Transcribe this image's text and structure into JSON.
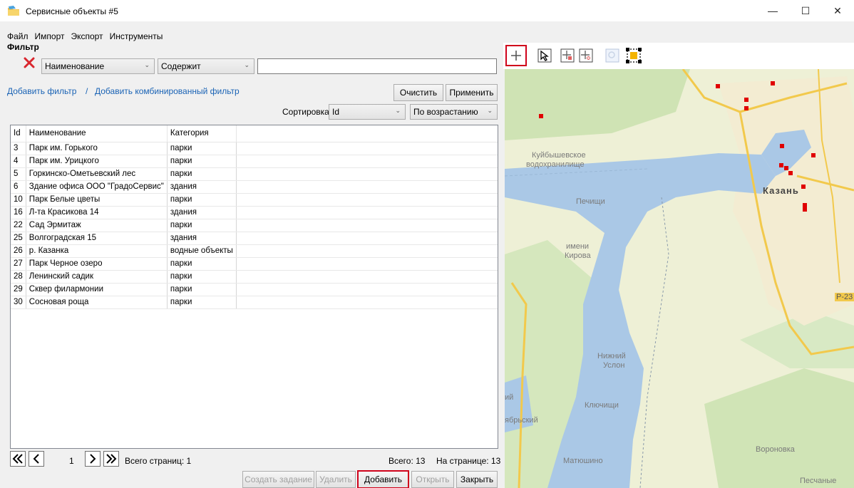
{
  "window": {
    "title": "Сервисные объекты #5",
    "minimize": "—",
    "maximize": "☐",
    "close": "✕"
  },
  "menu": [
    "Файл",
    "Импорт",
    "Экспорт",
    "Инструменты"
  ],
  "filter": {
    "label": "Фильтр",
    "field": "Наименование",
    "operator": "Содержит",
    "value": "",
    "add_filter": "Добавить фильтр",
    "separator": "/",
    "add_combined": "Добавить комбинированный фильтр",
    "clear": "Очистить",
    "apply": "Применить"
  },
  "sort": {
    "label": "Сортировка",
    "field": "Id",
    "direction": "По возрастанию"
  },
  "table": {
    "columns": [
      "Id",
      "Наименование",
      "Категория"
    ],
    "rows": [
      [
        "3",
        "Парк им. Горького",
        "парки"
      ],
      [
        "4",
        "Парк им. Урицкого",
        "парки"
      ],
      [
        "5",
        "Горкинско-Ометьевский лес",
        "парки"
      ],
      [
        "6",
        "Здание офиса ООО \"ГрадоСервис\"",
        "здания"
      ],
      [
        "10",
        "Парк Белые цветы",
        "парки"
      ],
      [
        "16",
        "Л-та Красикова 14",
        "здания"
      ],
      [
        "22",
        "Сад Эрмитаж",
        "парки"
      ],
      [
        "25",
        "Волгоградская 15",
        "здания"
      ],
      [
        "26",
        "р. Казанка",
        "водные объекты"
      ],
      [
        "27",
        "Парк Черное озеро",
        "парки"
      ],
      [
        "28",
        "Ленинский садик",
        "парки"
      ],
      [
        "29",
        "Сквер филармонии",
        "парки"
      ],
      [
        "30",
        "Сосновая роща",
        "парки"
      ]
    ]
  },
  "pager": {
    "first": "«",
    "prev": "‹",
    "page": "1",
    "next": "›",
    "last": "»",
    "total_pages": "Всего страниц: 1",
    "total": "Всего: 13",
    "per_page": "На странице: 13"
  },
  "actions": {
    "create_task": "Создать задание",
    "delete": "Удалить",
    "add": "Добавить",
    "open": "Открыть",
    "close": "Закрыть"
  },
  "map": {
    "labels": {
      "reservoir1": "Куйбышевское",
      "reservoir2": "водохранилище",
      "kazan": "Казань",
      "pechishchi": "Печищи",
      "imeni1": "имени",
      "imeni2": "Кирова",
      "nizhny1": "Нижний",
      "nizhny2": "Услон",
      "klyuchishchi": "Ключищи",
      "oktyabrsky": "ябрьский",
      "matyushino": "Матюшино",
      "voronovka": "Вороновка",
      "peschanye": "Песчаные",
      "road": "Р-23",
      "edge": "ий"
    }
  },
  "colors": {
    "highlight": "#d0021b",
    "marker": "#e00000",
    "link": "#1a63b5",
    "water": "#aac8e6"
  }
}
